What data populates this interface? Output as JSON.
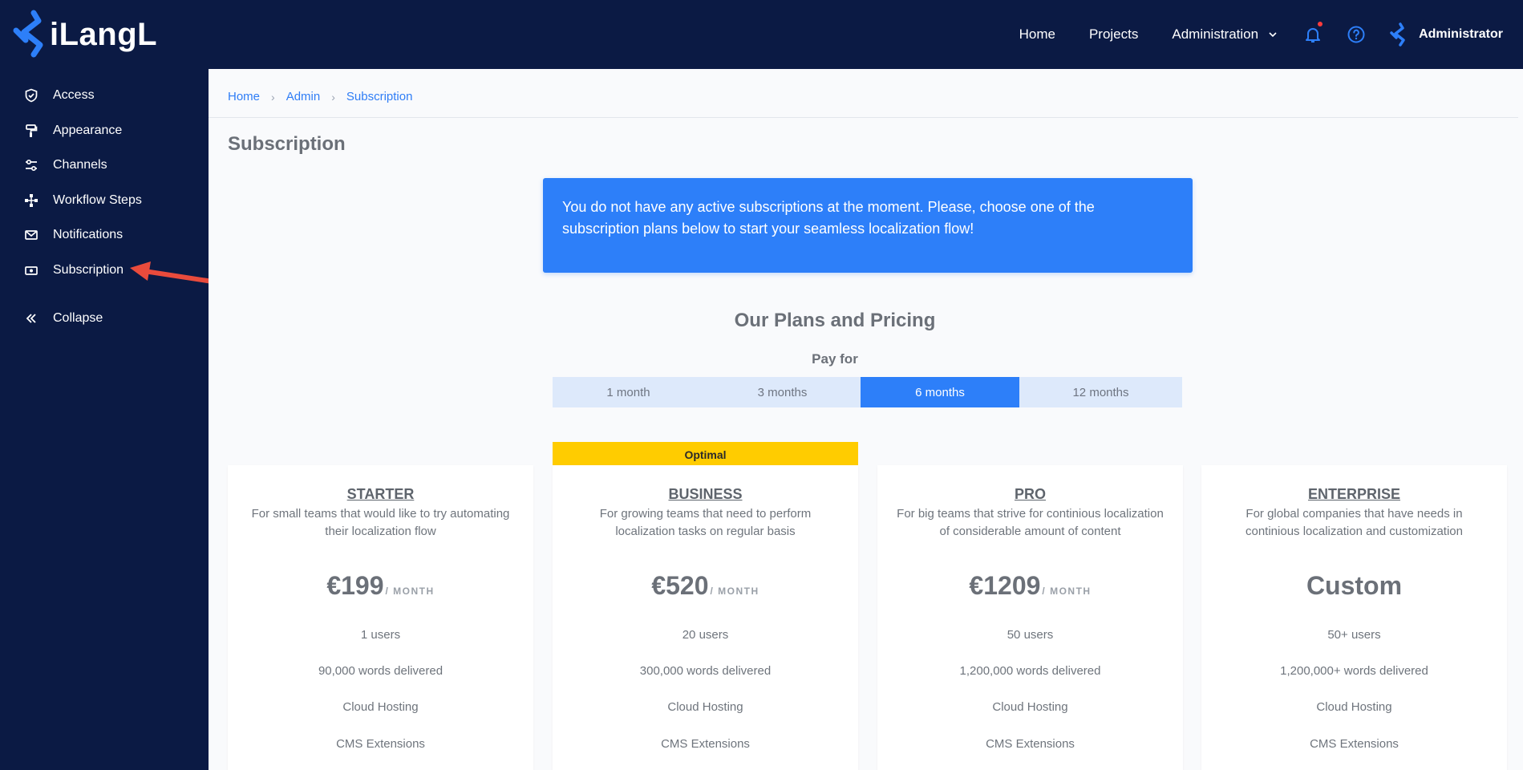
{
  "brand": {
    "name": "iLangL",
    "accent": "#2d7ff9",
    "navy": "#0b1a44"
  },
  "topnav": {
    "home": "Home",
    "projects": "Projects",
    "administration": "Administration",
    "user_name": "Administrator",
    "icons": [
      "bell-icon",
      "help-icon",
      "user-logo-icon"
    ]
  },
  "sidebar": {
    "items": [
      {
        "label": "Access",
        "icon": "shield-check-icon"
      },
      {
        "label": "Appearance",
        "icon": "paint-roller-icon"
      },
      {
        "label": "Channels",
        "icon": "sliders-icon"
      },
      {
        "label": "Workflow Steps",
        "icon": "flow-icon"
      },
      {
        "label": "Notifications",
        "icon": "envelope-icon"
      },
      {
        "label": "Subscription",
        "icon": "money-icon"
      }
    ],
    "collapse": "Collapse"
  },
  "breadcrumb": [
    "Home",
    "Admin",
    "Subscription"
  ],
  "page_title": "Subscription",
  "alert_text": "You do not have any active subscriptions at the moment. Please, choose one of the subscription plans below to start your seamless localization flow!",
  "plans": {
    "title": "Our Plans and Pricing",
    "pay_for": "Pay for",
    "periods": [
      "1 month",
      "3 months",
      "6 months",
      "12 months"
    ],
    "selected_period": "6 months",
    "optimal_badge": "Optimal",
    "price_unit": "/ MONTH",
    "cards": [
      {
        "name": "STARTER",
        "desc": "For small teams that would like to try automating their localization flow",
        "price": "€199",
        "users": "1 users",
        "words": "90,000 words delivered",
        "hosting": "Cloud Hosting",
        "cms": "CMS Extensions"
      },
      {
        "name": "BUSINESS",
        "desc": "For growing teams that need to perform localization tasks on regular basis",
        "price": "€520",
        "users": "20 users",
        "words": "300,000 words delivered",
        "hosting": "Cloud Hosting",
        "cms": "CMS Extensions"
      },
      {
        "name": "PRO",
        "desc": "For big teams that strive for continious localization of considerable amount of content",
        "price": "€1209",
        "users": "50 users",
        "words": "1,200,000 words delivered",
        "hosting": "Cloud Hosting",
        "cms": "CMS Extensions"
      },
      {
        "name": "ENTERPRISE",
        "desc": "For global companies that have needs in continious localization and customization",
        "price": "Custom",
        "users": "50+ users",
        "words": "1,200,000+ words delivered",
        "hosting": "Cloud Hosting",
        "cms": "CMS Extensions"
      }
    ]
  }
}
